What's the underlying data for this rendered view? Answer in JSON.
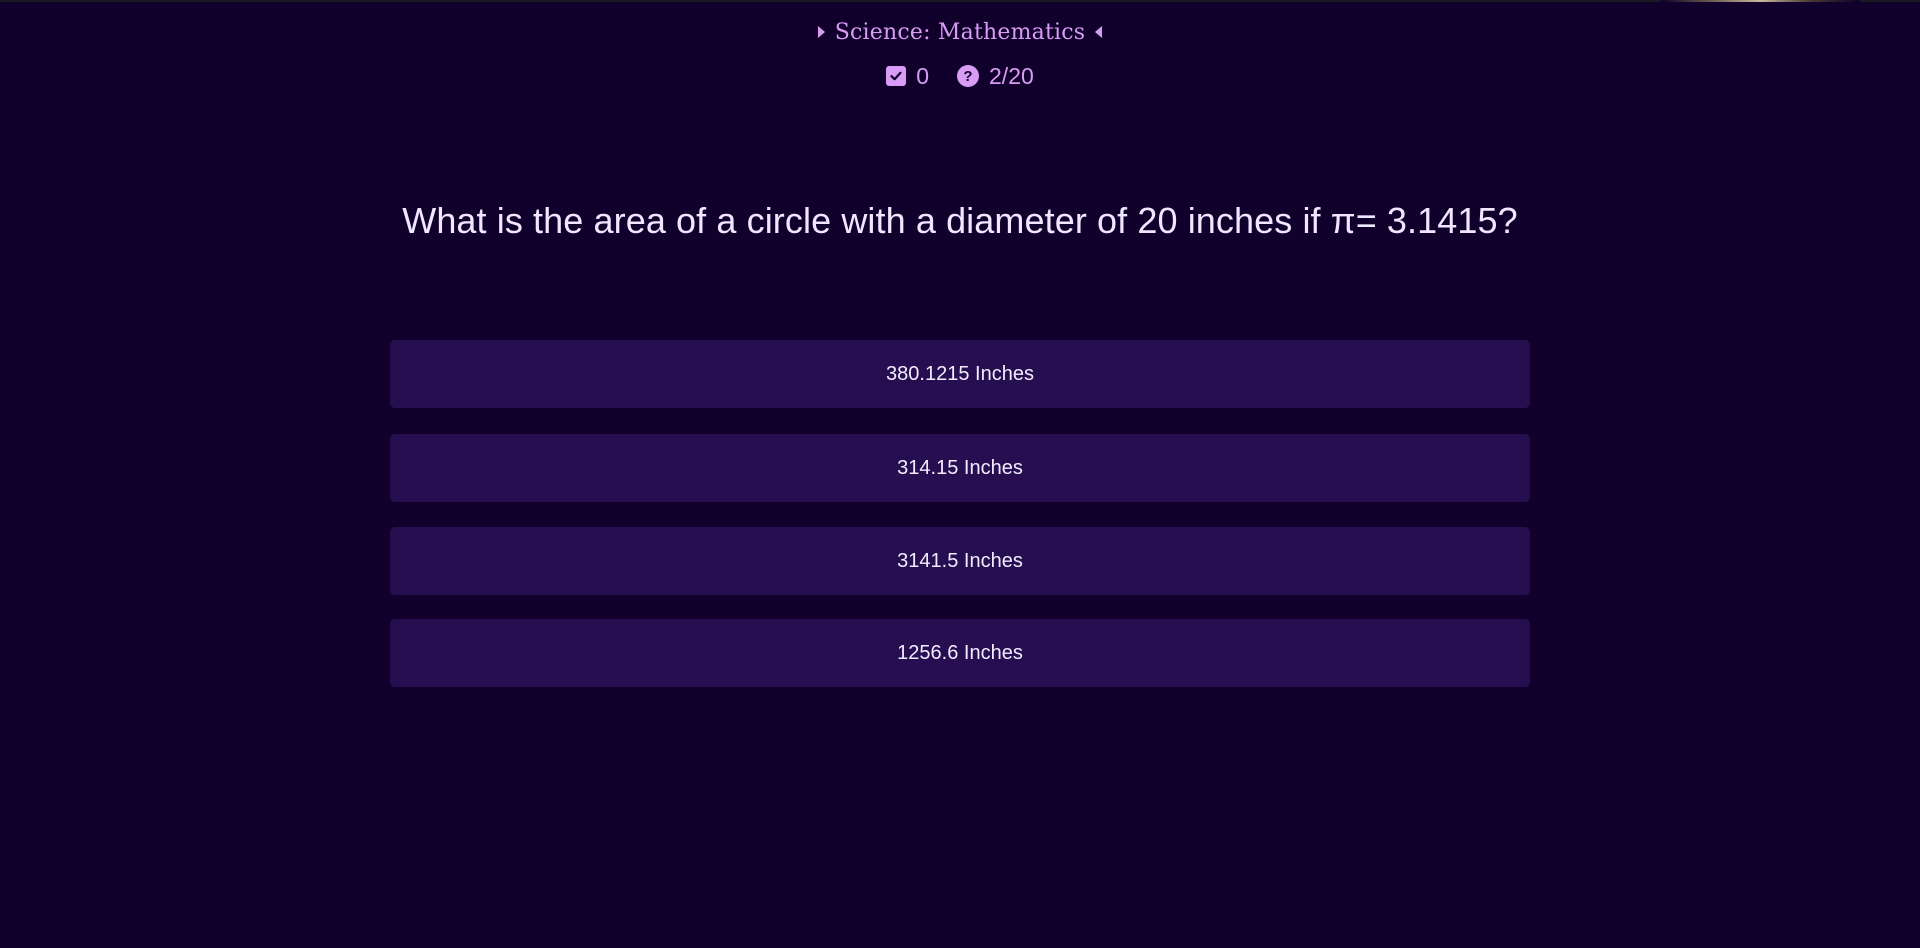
{
  "header": {
    "category": "Science: Mathematics"
  },
  "stats": {
    "correct_count": "0",
    "question_progress": "2/20"
  },
  "quiz": {
    "question": "What is the area of a circle with a diameter of 20 inches if π= 3.1415?",
    "answers": [
      {
        "label": "380.1215 Inches"
      },
      {
        "label": "314.15 Inches"
      },
      {
        "label": "3141.5 Inches"
      },
      {
        "label": "1256.6 Inches"
      }
    ]
  },
  "colors": {
    "background": "#10002b",
    "accent": "#d99cf5",
    "answer_bg": "#260e50",
    "text": "#efe6ff"
  }
}
